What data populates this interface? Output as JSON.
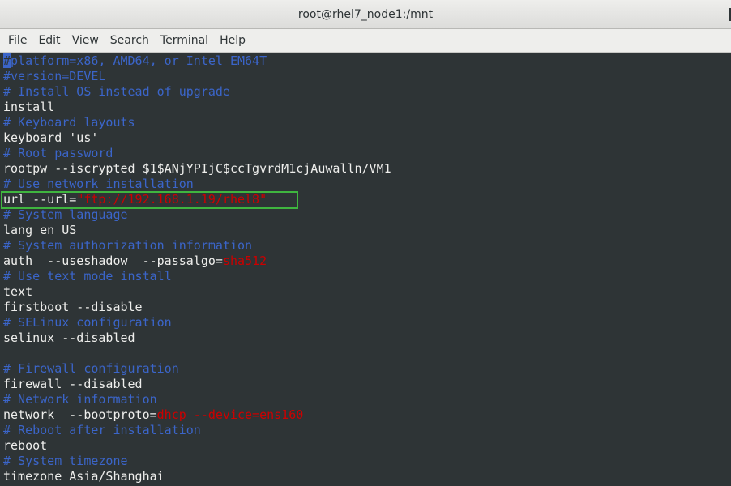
{
  "window": {
    "title": "root@rhel7_node1:/mnt"
  },
  "menu": [
    "File",
    "Edit",
    "View",
    "Search",
    "Terminal",
    "Help"
  ],
  "colors": {
    "terminal_bg": "#2e3436",
    "comment": "#3b65c9",
    "text": "#eeeeec",
    "string": "#cc0000",
    "highlight_box": "#3fb53f"
  },
  "terminal": {
    "first_char": "#",
    "lines": [
      {
        "seg": [
          {
            "t": "platform=x86, AMD64, or Intel EM64T",
            "c": "comment"
          }
        ]
      },
      {
        "seg": [
          {
            "t": "#version=DEVEL",
            "c": "comment"
          }
        ]
      },
      {
        "seg": [
          {
            "t": "# Install OS instead of upgrade",
            "c": "comment"
          }
        ]
      },
      {
        "seg": [
          {
            "t": "install",
            "c": "text"
          }
        ]
      },
      {
        "seg": [
          {
            "t": "# Keyboard layouts",
            "c": "comment"
          }
        ]
      },
      {
        "seg": [
          {
            "t": "keyboard 'us'",
            "c": "text"
          }
        ]
      },
      {
        "seg": [
          {
            "t": "# Root password",
            "c": "comment"
          }
        ]
      },
      {
        "seg": [
          {
            "t": "rootpw --iscrypted $1$ANjYPIjC$ccTgvrdM1cjAuwalln/VM1",
            "c": "text"
          }
        ]
      },
      {
        "seg": [
          {
            "t": "# Use network installation",
            "c": "comment"
          }
        ]
      },
      {
        "seg": [
          {
            "t": "url --url=",
            "c": "text"
          },
          {
            "t": "\"ftp://192.168.1.19/rhel8\"",
            "c": "red"
          }
        ]
      },
      {
        "seg": [
          {
            "t": "# System language",
            "c": "comment"
          }
        ]
      },
      {
        "seg": [
          {
            "t": "lang en_US",
            "c": "text"
          }
        ]
      },
      {
        "seg": [
          {
            "t": "# System authorization information",
            "c": "comment"
          }
        ]
      },
      {
        "seg": [
          {
            "t": "auth  --useshadow  --passalgo=",
            "c": "text"
          },
          {
            "t": "sha512",
            "c": "red"
          }
        ]
      },
      {
        "seg": [
          {
            "t": "# Use text mode install",
            "c": "comment"
          }
        ]
      },
      {
        "seg": [
          {
            "t": "text",
            "c": "text"
          }
        ]
      },
      {
        "seg": [
          {
            "t": "firstboot --disable",
            "c": "text"
          }
        ]
      },
      {
        "seg": [
          {
            "t": "# SELinux configuration",
            "c": "comment"
          }
        ]
      },
      {
        "seg": [
          {
            "t": "selinux --disabled",
            "c": "text"
          }
        ]
      },
      {
        "seg": []
      },
      {
        "seg": [
          {
            "t": "# Firewall configuration",
            "c": "comment"
          }
        ]
      },
      {
        "seg": [
          {
            "t": "firewall --disabled",
            "c": "text"
          }
        ]
      },
      {
        "seg": [
          {
            "t": "# Network information",
            "c": "comment"
          }
        ]
      },
      {
        "seg": [
          {
            "t": "network  --bootproto=",
            "c": "text"
          },
          {
            "t": "dhcp --device=ens160",
            "c": "red"
          }
        ]
      },
      {
        "seg": [
          {
            "t": "# Reboot after installation",
            "c": "comment"
          }
        ]
      },
      {
        "seg": [
          {
            "t": "reboot",
            "c": "text"
          }
        ]
      },
      {
        "seg": [
          {
            "t": "# System timezone",
            "c": "comment"
          }
        ]
      },
      {
        "seg": [
          {
            "t": "timezone Asia/Shanghai",
            "c": "text"
          }
        ]
      }
    ]
  }
}
